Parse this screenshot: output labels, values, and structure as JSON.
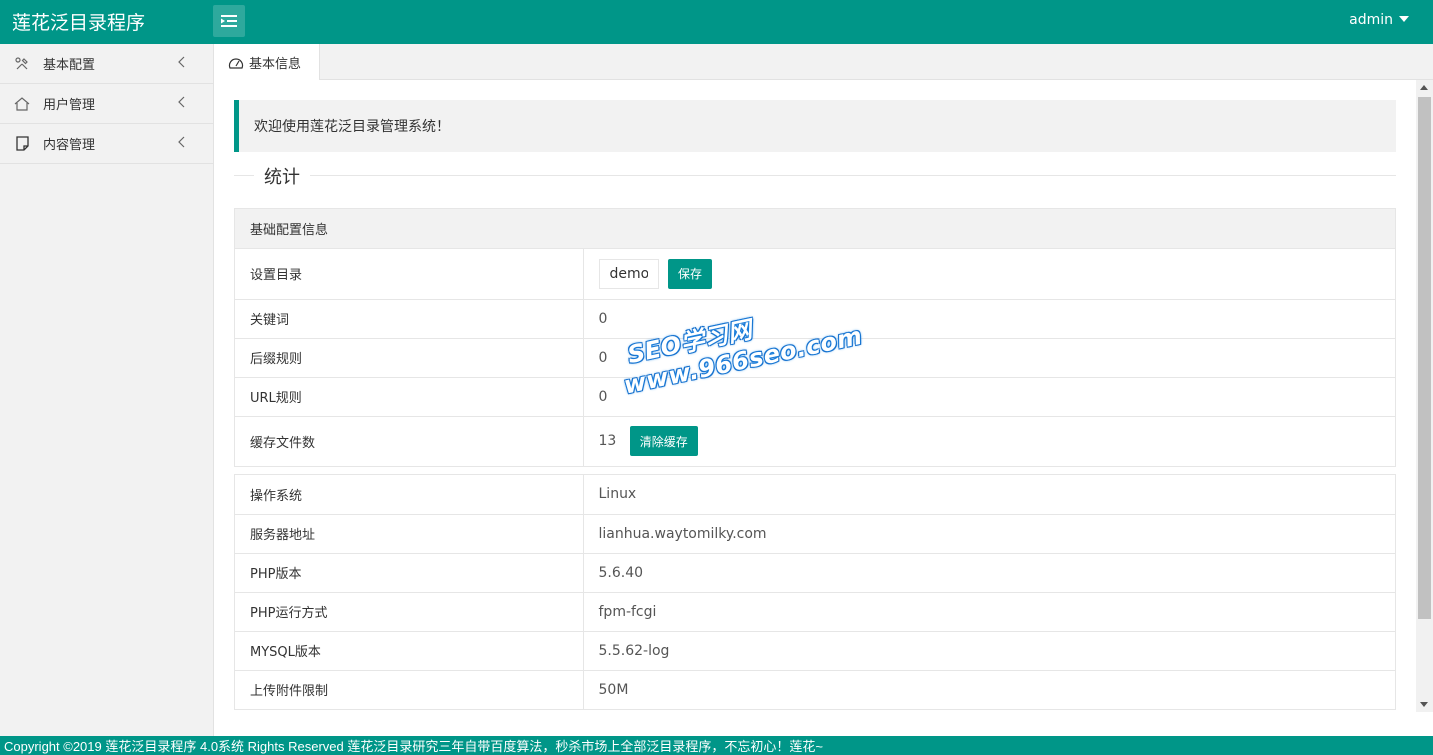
{
  "header": {
    "logo": "莲花泛目录程序",
    "user": "admin"
  },
  "sidebar": {
    "items": [
      {
        "label": "基本配置",
        "icon": "tools-icon"
      },
      {
        "label": "用户管理",
        "icon": "home-icon"
      },
      {
        "label": "内容管理",
        "icon": "note-icon"
      }
    ]
  },
  "tabs": [
    {
      "label": "基本信息",
      "icon": "dashboard-icon"
    }
  ],
  "welcome": "欢迎使用莲花泛目录管理系统！",
  "legend": "统计",
  "config_panel": {
    "title": "基础配置信息",
    "rows": [
      {
        "key": "设置目录",
        "input_value": "demo",
        "button": "保存"
      },
      {
        "key": "关键词",
        "value": "0"
      },
      {
        "key": "后缀规则",
        "value": "0"
      },
      {
        "key": "URL规则",
        "value": "0"
      },
      {
        "key": "缓存文件数",
        "value": "13",
        "button": "清除缓存"
      }
    ]
  },
  "system_panel": {
    "rows": [
      {
        "key": "操作系统",
        "value": "Linux"
      },
      {
        "key": "服务器地址",
        "value": "lianhua.waytomilky.com"
      },
      {
        "key": "PHP版本",
        "value": "5.6.40"
      },
      {
        "key": "PHP运行方式",
        "value": "fpm-fcgi"
      },
      {
        "key": "MYSQL版本",
        "value": "5.5.62-log"
      },
      {
        "key": "上传附件限制",
        "value": "50M"
      }
    ]
  },
  "watermark": {
    "line1": "SEO学习网",
    "line2": "www.966seo.com"
  },
  "footer": "Copyright ©2019 莲花泛目录程序 4.0系统 Rights Reserved 莲花泛目录研究三年自带百度算法，秒杀市场上全部泛目录程序，不忘初心！莲花~",
  "colors": {
    "accent": "#009688",
    "sidebar_bg": "#f2f2f2"
  }
}
